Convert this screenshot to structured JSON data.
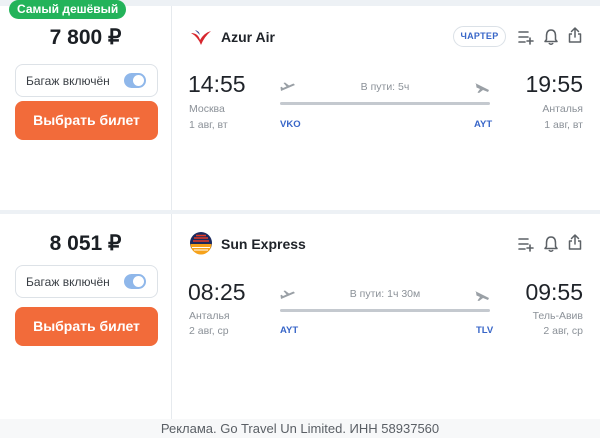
{
  "colors": {
    "accent_orange": "#f26b3a",
    "badge_green": "#23b35a",
    "code_blue": "#3866c8",
    "toggle_blue": "#8fb7ea"
  },
  "tickets": [
    {
      "badge": "Самый дешёвый",
      "price": "7 800 ₽",
      "baggage_label": "Багаж включён",
      "baggage_included": true,
      "buy_label": "Выбрать билет",
      "airline": "Azur Air",
      "airline_logo": "azur-air-logo",
      "charter_label": "ЧАРТЕР",
      "icons": [
        "add-to-list-icon",
        "bell-icon",
        "share-icon"
      ],
      "departure": {
        "time": "14:55",
        "city": "Москва",
        "date": "1 авг, вт",
        "code": "VKO"
      },
      "duration": "В пути: 5ч",
      "arrival": {
        "time": "19:55",
        "city": "Анталья",
        "date": "1 авг, вт",
        "code": "AYT"
      }
    },
    {
      "price": "8 051 ₽",
      "baggage_label": "Багаж включён",
      "baggage_included": true,
      "buy_label": "Выбрать билет",
      "airline": "Sun Express",
      "airline_logo": "sun-express-logo",
      "icons": [
        "add-to-list-icon",
        "bell-icon",
        "share-icon"
      ],
      "departure": {
        "time": "08:25",
        "city": "Анталья",
        "date": "2 авг, ср",
        "code": "AYT"
      },
      "duration": "В пути: 1ч 30м",
      "arrival": {
        "time": "09:55",
        "city": "Тель-Авив",
        "date": "2 авг, ср",
        "code": "TLV"
      }
    }
  ],
  "footer": {
    "ad_text": "Реклама. Go Travel Un Limited. ИНН 58937560"
  }
}
